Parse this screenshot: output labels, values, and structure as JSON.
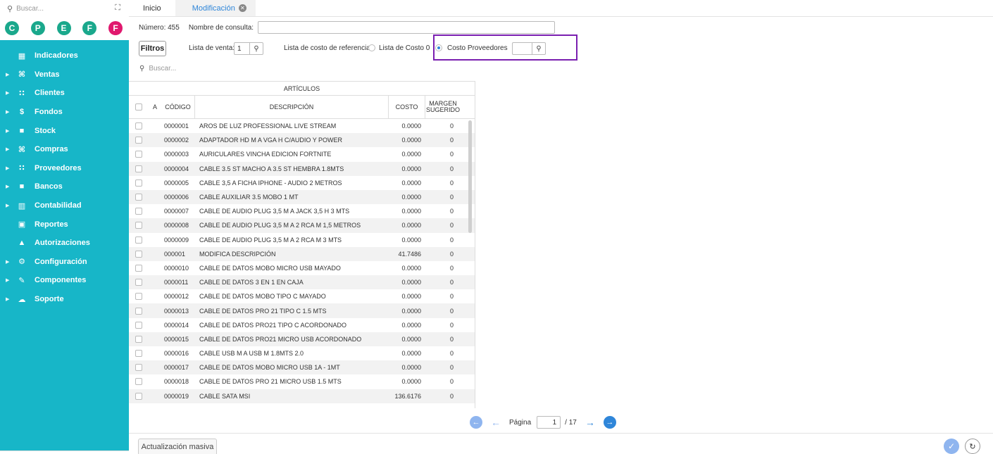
{
  "sidebar": {
    "search_placeholder": "Buscar...",
    "avatars": [
      {
        "letter": "C",
        "color": "#1aa88c"
      },
      {
        "letter": "P",
        "color": "#1aa88c"
      },
      {
        "letter": "E",
        "color": "#1aa88c"
      },
      {
        "letter": "F",
        "color": "#1aa88c"
      },
      {
        "letter": "F",
        "color": "#e0186e"
      }
    ],
    "menu": [
      {
        "label": "Indicadores",
        "icon": "grid-icon",
        "arrow": false
      },
      {
        "label": "Ventas",
        "icon": "cart-icon",
        "arrow": true
      },
      {
        "label": "Clientes",
        "icon": "users-icon",
        "arrow": true
      },
      {
        "label": "Fondos",
        "icon": "dollar-icon",
        "arrow": true
      },
      {
        "label": "Stock",
        "icon": "box-icon",
        "arrow": true
      },
      {
        "label": "Compras",
        "icon": "cart-buy-icon",
        "arrow": true
      },
      {
        "label": "Proveedores",
        "icon": "users-icon",
        "arrow": true
      },
      {
        "label": "Bancos",
        "icon": "briefcase-icon",
        "arrow": true
      },
      {
        "label": "Contabilidad",
        "icon": "book-icon",
        "arrow": true
      },
      {
        "label": "Reportes",
        "icon": "report-icon",
        "arrow": false
      },
      {
        "label": "Autorizaciones",
        "icon": "lock-icon",
        "arrow": false
      },
      {
        "label": "Configuración",
        "icon": "cogs-icon",
        "arrow": true
      },
      {
        "label": "Componentes",
        "icon": "pencil-icon",
        "arrow": true
      },
      {
        "label": "Soporte",
        "icon": "cloud-icon",
        "arrow": true
      }
    ]
  },
  "tabs": {
    "inicio": "Inicio",
    "modificacion": "Modificación"
  },
  "form": {
    "numero_label": "Número: 455",
    "nombre_label": "Nombre de consulta:",
    "nombre_value": "",
    "filtros_label": "Filtros",
    "lista_venta_label": "Lista de venta:",
    "lista_venta_value": "1",
    "lista_costo_label": "Lista de costo de referencia:",
    "opt_lista_costo": "Lista de Costo 0",
    "opt_costo_proveedores": "Costo Proveedores",
    "proveedor_value": "",
    "table_search_placeholder": "Buscar..."
  },
  "table": {
    "group_header": "ARTÍCULOS",
    "headers": {
      "a": "A",
      "codigo": "CÓDIGO",
      "descripcion": "DESCRIPCIÓN",
      "costo": "COSTO",
      "margen": "MARGEN SUGERIDO"
    },
    "rows": [
      {
        "codigo": "0000001",
        "descripcion": "AROS DE LUZ PROFESSIONAL LIVE STREAM",
        "costo": "0.0000",
        "margen": "0"
      },
      {
        "codigo": "0000002",
        "descripcion": "ADAPTADOR HD M A VGA H C/AUDIO Y POWER",
        "costo": "0.0000",
        "margen": "0"
      },
      {
        "codigo": "0000003",
        "descripcion": "AURICULARES VINCHA EDICION FORTNITE",
        "costo": "0.0000",
        "margen": "0"
      },
      {
        "codigo": "0000004",
        "descripcion": "CABLE 3.5 ST MACHO A 3.5 ST HEMBRA 1.8MTS",
        "costo": "0.0000",
        "margen": "0"
      },
      {
        "codigo": "0000005",
        "descripcion": "CABLE 3,5 A FICHA IPHONE - AUDIO 2 METROS",
        "costo": "0.0000",
        "margen": "0"
      },
      {
        "codigo": "0000006",
        "descripcion": "CABLE AUXILIAR 3.5 MOBO 1 MT",
        "costo": "0.0000",
        "margen": "0"
      },
      {
        "codigo": "0000007",
        "descripcion": "CABLE DE AUDIO PLUG 3,5 M A JACK 3,5 H 3 MTS",
        "costo": "0.0000",
        "margen": "0"
      },
      {
        "codigo": "0000008",
        "descripcion": "CABLE DE AUDIO PLUG 3,5 M A 2 RCA M 1,5 METROS",
        "costo": "0.0000",
        "margen": "0"
      },
      {
        "codigo": "0000009",
        "descripcion": "CABLE DE AUDIO PLUG 3,5 M A 2 RCA M 3 MTS",
        "costo": "0.0000",
        "margen": "0"
      },
      {
        "codigo": "000001",
        "descripcion": "MODIFICA DESCRIPCIÓN",
        "costo": "41.7486",
        "margen": "0"
      },
      {
        "codigo": "0000010",
        "descripcion": "CABLE DE DATOS MOBO MICRO USB MAYADO",
        "costo": "0.0000",
        "margen": "0"
      },
      {
        "codigo": "0000011",
        "descripcion": "CABLE DE DATOS 3 EN 1 EN CAJA",
        "costo": "0.0000",
        "margen": "0"
      },
      {
        "codigo": "0000012",
        "descripcion": "CABLE DE DATOS MOBO TIPO C MAYADO",
        "costo": "0.0000",
        "margen": "0"
      },
      {
        "codigo": "0000013",
        "descripcion": "CABLE DE DATOS PRO 21 TIPO C 1.5 MTS",
        "costo": "0.0000",
        "margen": "0"
      },
      {
        "codigo": "0000014",
        "descripcion": "CABLE DE DATOS PRO21 TIPO C ACORDONADO",
        "costo": "0.0000",
        "margen": "0"
      },
      {
        "codigo": "0000015",
        "descripcion": "CABLE DE DATOS PRO21 MICRO USB ACORDONADO",
        "costo": "0.0000",
        "margen": "0"
      },
      {
        "codigo": "0000016",
        "descripcion": "CABLE USB M A USB M 1.8MTS 2.0",
        "costo": "0.0000",
        "margen": "0"
      },
      {
        "codigo": "0000017",
        "descripcion": "CABLE DE DATOS MOBO MICRO USB 1A - 1MT",
        "costo": "0.0000",
        "margen": "0"
      },
      {
        "codigo": "0000018",
        "descripcion": "CABLE DE DATOS PRO 21 MICRO USB 1.5 MTS",
        "costo": "0.0000",
        "margen": "0"
      },
      {
        "codigo": "0000019",
        "descripcion": "CABLE SATA MSI",
        "costo": "136.6176",
        "margen": "0"
      }
    ]
  },
  "pager": {
    "label": "Página",
    "current": "1",
    "total": "/ 17"
  },
  "footer": {
    "masiva_label": "Actualización masiva"
  },
  "colors": {
    "accent": "#2f86d9",
    "sidebar_bg": "#17b6c8",
    "highlight": "#7a1fb0"
  }
}
